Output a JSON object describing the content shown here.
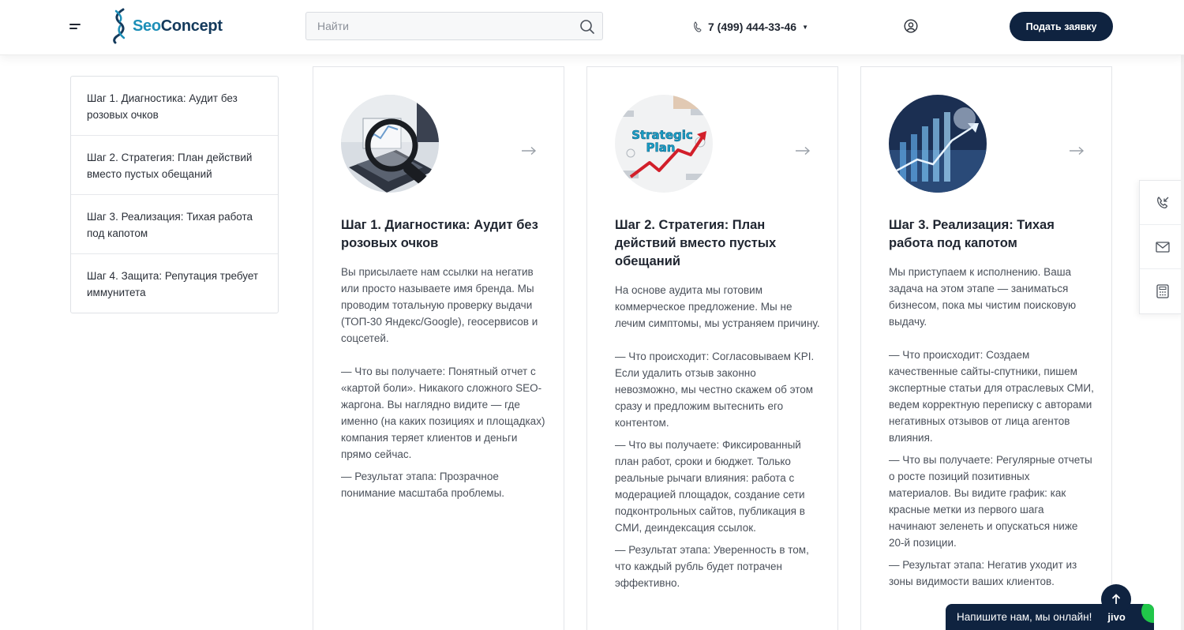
{
  "header": {
    "logo": {
      "seo": "Seo",
      "concept": "Concept"
    },
    "search": {
      "placeholder": "Найти"
    },
    "phone": "7 (499) 444-33-46",
    "cta": "Подать заявку"
  },
  "sidebar": {
    "items": [
      {
        "label": "Шаг 1. Диагностика: Аудит без розовых очков"
      },
      {
        "label": "Шаг 2. Стратегия: План действий вместо пустых обещаний"
      },
      {
        "label": "Шаг 3. Реализация: Тихая работа под капотом"
      },
      {
        "label": "Шаг 4. Защита: Репутация требует иммунитета"
      }
    ]
  },
  "cards": [
    {
      "title": "Шаг 1. Диагностика: Аудит без розовых очков",
      "image": "magnifier-laptop-analytics",
      "intro": "Вы присылаете нам ссылки на негатив или просто называете имя бренда. Мы проводим тотальную проверку выдачи (ТОП-30 Яндекс/Google), геосервисов и соцсетей.",
      "bullets": [
        "—  Что вы получаете: Понятный отчет с «картой боли». Никакого сложного SEO-жаргона. Вы наглядно видите — где именно (на каких позициях и площадках) компания теряет клиентов и деньги прямо сейчас.",
        "—  Результат этапа: Прозрачное понимание масштаба проблемы."
      ]
    },
    {
      "title": "Шаг 2. Стратегия: План действий вместо пустых обещаний",
      "image": "strategic-plan-whiteboard",
      "image_text": {
        "line1": "Strategic",
        "line2": "Plan"
      },
      "intro": "На основе аудита мы готовим коммерческое предложение. Мы не лечим симптомы, мы устраняем причину.",
      "bullets": [
        "—  Что происходит: Согласовываем KPI. Если удалить отзыв законно невозможно, мы честно скажем об этом сразу и предложим вытеснить его контентом.",
        "—  Что вы получаете: Фиксированный план работ, сроки и бюджет. Только реальные рычаги влияния: работа с модерацией площадок, создание сети подконтрольных сайтов, публикация в СМИ, деиндексация ссылок.",
        "—  Результат этапа: Уверенность в том, что каждый рубль будет потрачен эффективно."
      ]
    },
    {
      "title": "Шаг 3. Реализация: Тихая работа под капотом",
      "image": "digital-growth-chart",
      "intro": "Мы приступаем к исполнению. Ваша задача на этом этапе — заниматься бизнесом, пока мы чистим поисковую выдачу.",
      "bullets": [
        "—  Что происходит: Создаем качественные сайты-спутники, пишем экспертные статьи для отраслевых СМИ, ведем корректную переписку с авторами негативных отзывов от лица агентов влияния.",
        "—  Что вы получаете: Регулярные отчеты о росте позиций позитивных материалов. Вы видите график: как красные метки из первого шага начинают зеленеть и опускаться ниже 20-й позиции.",
        "—  Результат этапа: Негатив уходит из зоны видимости ваших клиентов."
      ]
    }
  ],
  "float_panel": {
    "icons": [
      "callback-icon",
      "mail-icon",
      "calculator-icon"
    ]
  },
  "chat": {
    "text": "Напишите нам, мы онлайн!",
    "brand": "jivo"
  },
  "colors": {
    "navy": "#0f2340",
    "accent": "#1d8fb8",
    "chat_online": "#21c64a"
  }
}
